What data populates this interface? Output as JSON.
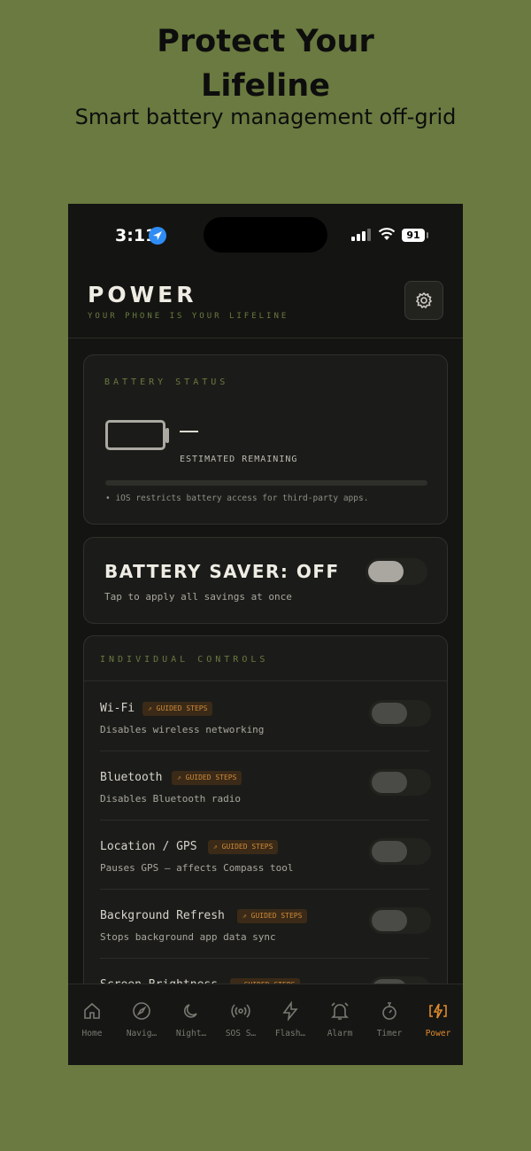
{
  "promo": {
    "headline_line1": "Protect Your",
    "headline_line2": "Lifeline",
    "subheadline": "Smart battery management off-grid"
  },
  "status_bar": {
    "time": "3:11",
    "battery_percent": "91"
  },
  "header": {
    "title": "POWER",
    "tagline": "YOUR PHONE IS YOUR LIFELINE",
    "settings_icon": "gear-icon"
  },
  "battery_status": {
    "label": "BATTERY STATUS",
    "value": "—",
    "estimate_label": "ESTIMATED REMAINING",
    "note": "• iOS restricts battery access for third-party apps."
  },
  "battery_saver": {
    "title": "BATTERY SAVER: OFF",
    "subtitle": "Tap to apply all savings at once"
  },
  "controls": {
    "label": "INDIVIDUAL CONTROLS",
    "badge_text": "GUIDED STEPS",
    "items": [
      {
        "name": "Wi-Fi",
        "desc": "Disables wireless networking"
      },
      {
        "name": "Bluetooth",
        "desc": "Disables Bluetooth radio"
      },
      {
        "name": "Location / GPS",
        "desc": "Pauses GPS — affects Compass tool"
      },
      {
        "name": "Background Refresh",
        "desc": "Stops background app data sync"
      },
      {
        "name": "Screen Brightness",
        "desc": ""
      }
    ]
  },
  "tabs": [
    {
      "label": "Home",
      "icon": "home-icon"
    },
    {
      "label": "Navig…",
      "icon": "compass-icon"
    },
    {
      "label": "Night…",
      "icon": "moon-icon"
    },
    {
      "label": "SOS S…",
      "icon": "broadcast-icon"
    },
    {
      "label": "Flash…",
      "icon": "lightning-icon"
    },
    {
      "label": "Alarm",
      "icon": "bell-icon"
    },
    {
      "label": "Timer",
      "icon": "stopwatch-icon"
    },
    {
      "label": "Power",
      "icon": "power-icon"
    }
  ],
  "colors": {
    "accent": "#e08a2c",
    "olive": "#6a7a40",
    "background": "#141512"
  }
}
